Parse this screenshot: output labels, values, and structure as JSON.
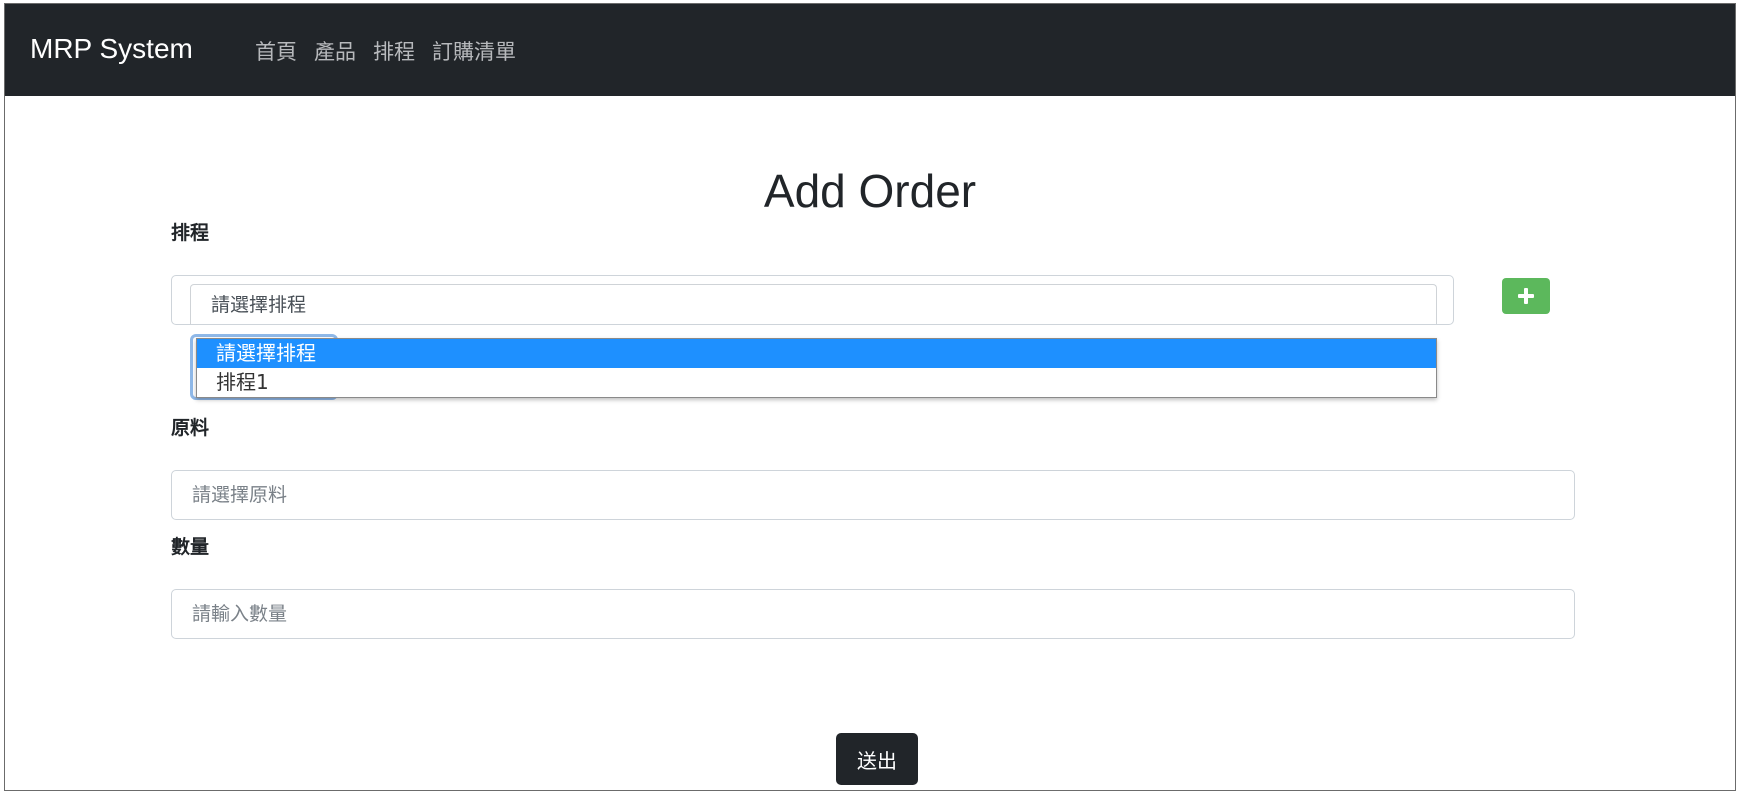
{
  "navbar": {
    "brand": "MRP System",
    "links": [
      {
        "label": "首頁"
      },
      {
        "label": "產品"
      },
      {
        "label": "排程"
      },
      {
        "label": "訂購清單"
      }
    ]
  },
  "page": {
    "title": "Add Order"
  },
  "form": {
    "schedule": {
      "label": "排程",
      "selected_value": "請選擇排程",
      "options": [
        {
          "label": "請選擇排程",
          "selected": true
        },
        {
          "label": "排程1",
          "selected": false
        }
      ]
    },
    "add_schedule_button": {
      "icon": "plus-icon",
      "color": "#5cb85c"
    },
    "material": {
      "label": "原料",
      "placeholder": "請選擇原料"
    },
    "quantity": {
      "label": "數量",
      "placeholder": "請輸入數量"
    },
    "submit_label": "送出"
  },
  "colors": {
    "navbar_bg": "#212529",
    "selected_option": "#1e90ff",
    "add_button": "#5cb85c",
    "submit_button": "#212529"
  }
}
